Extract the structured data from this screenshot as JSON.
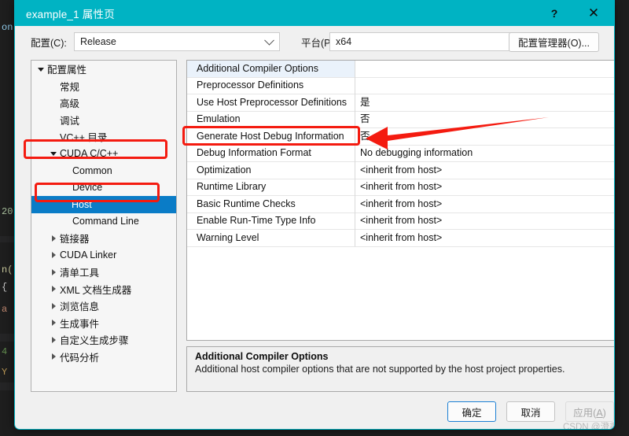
{
  "window": {
    "title": "example_1 属性页",
    "help_button": "?",
    "close_button": "✕",
    "titlebar_color": "#00b3c3"
  },
  "config_bar": {
    "configuration_label": "配置(C):",
    "configuration_value": "Release",
    "platform_label": "平台(P):",
    "platform_value": "x64",
    "config_manager_button": "配置管理器(O)..."
  },
  "tree": {
    "items": [
      {
        "label": "配置属性",
        "indent": 0,
        "twisty": "open",
        "selected": false
      },
      {
        "label": "常规",
        "indent": 1,
        "twisty": "none",
        "selected": false
      },
      {
        "label": "高级",
        "indent": 1,
        "twisty": "none",
        "selected": false
      },
      {
        "label": "调试",
        "indent": 1,
        "twisty": "none",
        "selected": false
      },
      {
        "label": "VC++ 目录",
        "indent": 1,
        "twisty": "none",
        "selected": false
      },
      {
        "label": "CUDA C/C++",
        "indent": 1,
        "twisty": "open",
        "selected": false
      },
      {
        "label": "Common",
        "indent": 2,
        "twisty": "none",
        "selected": false
      },
      {
        "label": "Device",
        "indent": 2,
        "twisty": "none",
        "selected": false
      },
      {
        "label": "Host",
        "indent": 2,
        "twisty": "none",
        "selected": true
      },
      {
        "label": "Command Line",
        "indent": 2,
        "twisty": "none",
        "selected": false
      },
      {
        "label": "链接器",
        "indent": 1,
        "twisty": "closed",
        "selected": false
      },
      {
        "label": "CUDA Linker",
        "indent": 1,
        "twisty": "closed",
        "selected": false
      },
      {
        "label": "清单工具",
        "indent": 1,
        "twisty": "closed",
        "selected": false
      },
      {
        "label": "XML 文档生成器",
        "indent": 1,
        "twisty": "closed",
        "selected": false
      },
      {
        "label": "浏览信息",
        "indent": 1,
        "twisty": "closed",
        "selected": false
      },
      {
        "label": "生成事件",
        "indent": 1,
        "twisty": "closed",
        "selected": false
      },
      {
        "label": "自定义生成步骤",
        "indent": 1,
        "twisty": "closed",
        "selected": false
      },
      {
        "label": "代码分析",
        "indent": 1,
        "twisty": "closed",
        "selected": false
      }
    ]
  },
  "grid": {
    "rows": [
      {
        "name": "Additional Compiler Options",
        "value": "",
        "selected": true
      },
      {
        "name": "Preprocessor Definitions",
        "value": "",
        "selected": false
      },
      {
        "name": "Use Host Preprocessor Definitions",
        "value": "是",
        "selected": false
      },
      {
        "name": "Emulation",
        "value": "否",
        "selected": false
      },
      {
        "name": "Generate Host Debug Information",
        "value": "否",
        "selected": false
      },
      {
        "name": "Debug Information Format",
        "value": "No debugging information",
        "selected": false
      },
      {
        "name": "Optimization",
        "value": "<inherit from host>",
        "selected": false
      },
      {
        "name": "Runtime Library",
        "value": "<inherit from host>",
        "selected": false
      },
      {
        "name": "Basic Runtime Checks",
        "value": "<inherit from host>",
        "selected": false
      },
      {
        "name": "Enable Run-Time Type Info",
        "value": "<inherit from host>",
        "selected": false
      },
      {
        "name": "Warning Level",
        "value": "<inherit from host>",
        "selected": false
      }
    ]
  },
  "description": {
    "title": "Additional Compiler Options",
    "body": "Additional host compiler options that are not supported by the host project properties."
  },
  "footer": {
    "ok_label": "确定",
    "cancel_label": "取消",
    "apply_label": "应用(A)",
    "apply_disabled": true
  },
  "watermark": "CSDN @澄鑫",
  "annotations": {
    "color": "#f41b10",
    "boxes": [
      "CUDA C/C++",
      "Host",
      "Generate Host Debug Information"
    ],
    "arrow_points_to": "否"
  },
  "background_editor": {
    "visible_fragments": [
      "on",
      "20",
      "n(",
      "{",
      "a",
      "4",
      "Y"
    ]
  }
}
